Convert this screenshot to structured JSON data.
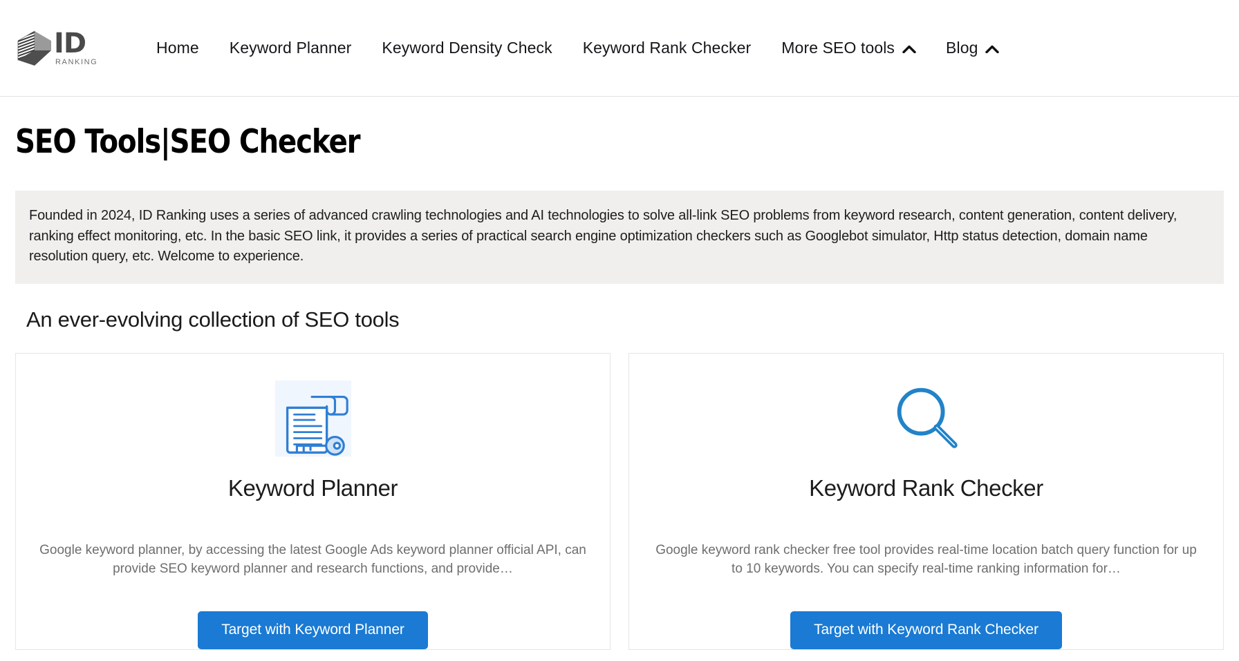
{
  "header": {
    "logo": {
      "name": "ID",
      "tagline": "RANKING",
      "icon": "cube-logo-icon"
    },
    "nav": [
      {
        "label": "Home",
        "icon": null
      },
      {
        "label": "Keyword Planner",
        "icon": null
      },
      {
        "label": "Keyword Density Check",
        "icon": null
      },
      {
        "label": "Keyword Rank Checker",
        "icon": null
      },
      {
        "label": "More SEO tools",
        "icon": "caret-up-icon"
      },
      {
        "label": "Blog",
        "icon": "caret-up-icon"
      }
    ]
  },
  "main": {
    "title": "SEO Tools|SEO Checker",
    "intro": "Founded in 2024, ID Ranking uses a series of advanced crawling technologies and AI technologies to solve all-link SEO problems from keyword research, content generation, content delivery, ranking effect monitoring, etc. In the basic SEO link, it provides a series of practical search engine optimization checkers such as Googlebot simulator, Http status detection, domain name resolution query, etc. Welcome to experience.",
    "section_title": "An ever-evolving collection of SEO tools",
    "cards": [
      {
        "icon": "document-key-icon",
        "title": "Keyword Planner",
        "description": "Google keyword planner, by accessing the latest Google Ads keyword planner official API, can provide SEO keyword planner and research functions, and provide…",
        "button_label": "Target with Keyword Planner"
      },
      {
        "icon": "magnifier-icon",
        "title": "Keyword Rank Checker",
        "description": "Google keyword rank checker free tool provides real-time location batch query function for up to 10 keywords. You can specify real-time ranking information for…",
        "button_label": "Target with Keyword Rank Checker"
      }
    ]
  },
  "colors": {
    "accent_blue": "#1a7ad4",
    "icon_blue": "#2283c8",
    "intro_bg": "#f0efed",
    "card_border": "#e6e6e6"
  }
}
